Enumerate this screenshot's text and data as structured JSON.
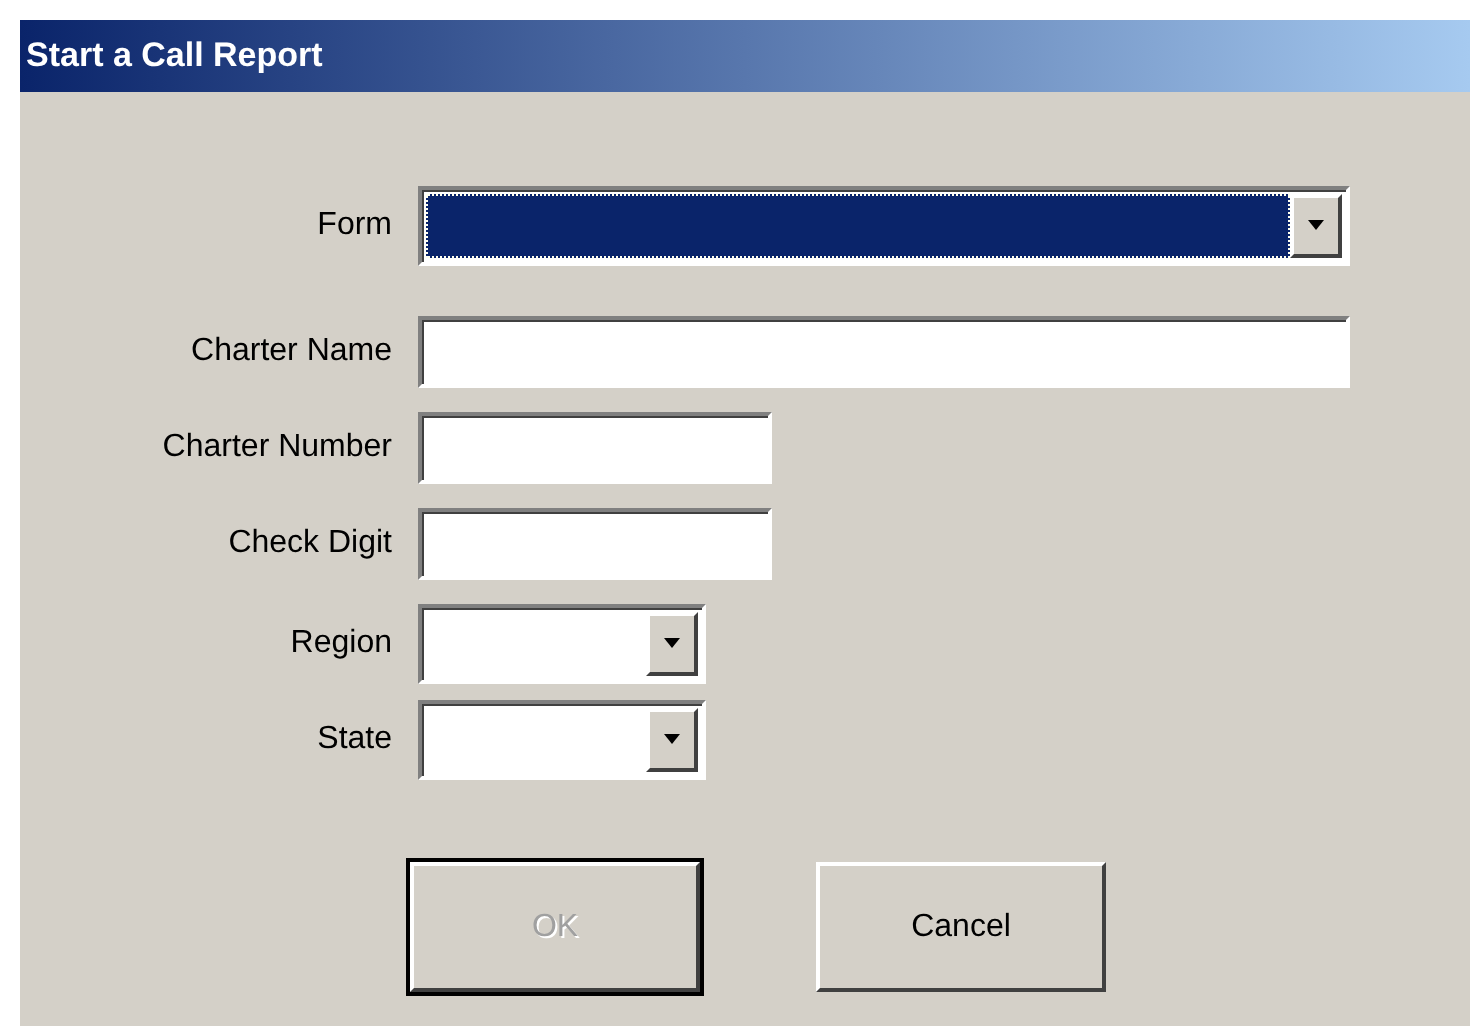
{
  "window": {
    "title": "Start a Call Report"
  },
  "fields": [
    {
      "label": "Form",
      "kind": "widecombo",
      "highlighted": true
    },
    {
      "label": "Charter Name",
      "kind": "widetext",
      "highlighted": false
    },
    {
      "label": "Charter Number",
      "kind": "text",
      "highlighted": false
    },
    {
      "label": "Check Digit",
      "kind": "text",
      "highlighted": false
    },
    {
      "label": "Region",
      "kind": "combo",
      "highlighted": false
    },
    {
      "label": "State",
      "kind": "combo",
      "highlighted": false
    }
  ],
  "buttons": [
    {
      "label": "OK",
      "disabled": true,
      "default": true
    },
    {
      "label": "Cancel",
      "disabled": false,
      "default": false
    }
  ]
}
